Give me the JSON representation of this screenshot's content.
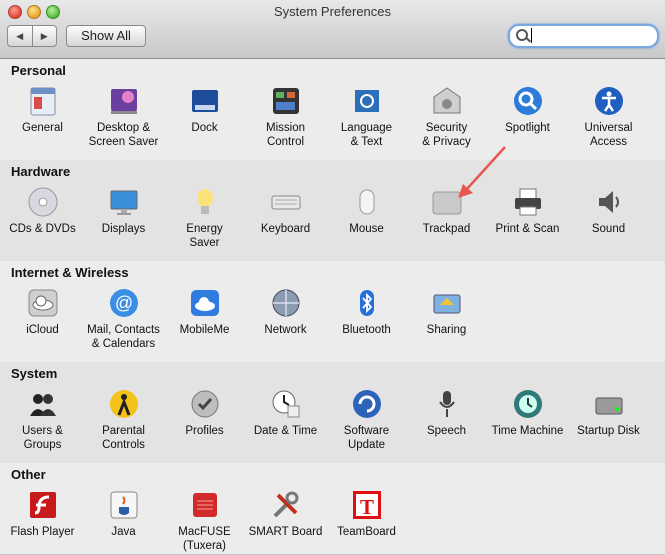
{
  "window": {
    "title": "System Preferences"
  },
  "toolbar": {
    "back": "◀",
    "forward": "▶",
    "show_all": "Show All",
    "search_value": ""
  },
  "sections": [
    {
      "title": "Personal",
      "items": [
        {
          "label": "General",
          "icon": "general-icon"
        },
        {
          "label": "Desktop &\nScreen Saver",
          "icon": "desktop-icon"
        },
        {
          "label": "Dock",
          "icon": "dock-icon"
        },
        {
          "label": "Mission\nControl",
          "icon": "mission-control-icon"
        },
        {
          "label": "Language\n& Text",
          "icon": "language-icon"
        },
        {
          "label": "Security\n& Privacy",
          "icon": "security-icon"
        },
        {
          "label": "Spotlight",
          "icon": "spotlight-icon"
        },
        {
          "label": "Universal\nAccess",
          "icon": "universal-access-icon"
        }
      ]
    },
    {
      "title": "Hardware",
      "items": [
        {
          "label": "CDs & DVDs",
          "icon": "cd-icon"
        },
        {
          "label": "Displays",
          "icon": "display-icon"
        },
        {
          "label": "Energy\nSaver",
          "icon": "bulb-icon"
        },
        {
          "label": "Keyboard",
          "icon": "keyboard-icon"
        },
        {
          "label": "Mouse",
          "icon": "mouse-icon"
        },
        {
          "label": "Trackpad",
          "icon": "trackpad-icon"
        },
        {
          "label": "Print & Scan",
          "icon": "printer-icon"
        },
        {
          "label": "Sound",
          "icon": "speaker-icon"
        }
      ]
    },
    {
      "title": "Internet & Wireless",
      "items": [
        {
          "label": "iCloud",
          "icon": "cloud-icon"
        },
        {
          "label": "Mail, Contacts\n& Calendars",
          "icon": "at-icon"
        },
        {
          "label": "MobileMe",
          "icon": "mobileme-icon"
        },
        {
          "label": "Network",
          "icon": "network-icon"
        },
        {
          "label": "Bluetooth",
          "icon": "bluetooth-icon"
        },
        {
          "label": "Sharing",
          "icon": "sharing-icon"
        }
      ]
    },
    {
      "title": "System",
      "items": [
        {
          "label": "Users &\nGroups",
          "icon": "users-icon"
        },
        {
          "label": "Parental\nControls",
          "icon": "parental-icon"
        },
        {
          "label": "Profiles",
          "icon": "profiles-icon"
        },
        {
          "label": "Date & Time",
          "icon": "clock-icon"
        },
        {
          "label": "Software\nUpdate",
          "icon": "update-icon"
        },
        {
          "label": "Speech",
          "icon": "microphone-icon"
        },
        {
          "label": "Time Machine",
          "icon": "time-machine-icon"
        },
        {
          "label": "Startup Disk",
          "icon": "disk-icon"
        }
      ]
    },
    {
      "title": "Other",
      "items": [
        {
          "label": "Flash Player",
          "icon": "flash-icon"
        },
        {
          "label": "Java",
          "icon": "java-icon"
        },
        {
          "label": "MacFUSE\n(Tuxera)",
          "icon": "macfuse-icon"
        },
        {
          "label": "SMART Board",
          "icon": "tools-icon"
        },
        {
          "label": "TeamBoard",
          "icon": "teamboard-icon"
        }
      ]
    }
  ],
  "annotation": {
    "arrow_color": "#e8574f"
  }
}
